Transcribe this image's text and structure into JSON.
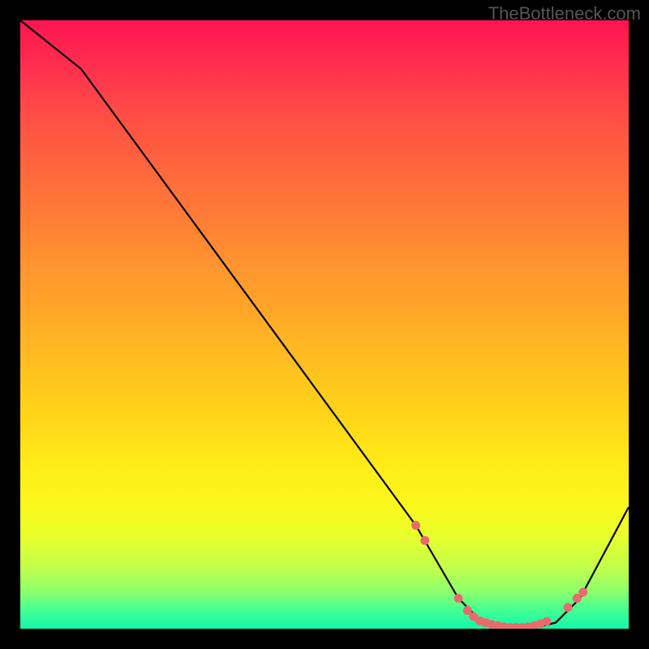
{
  "watermark": "TheBottleneck.com",
  "chart_data": {
    "type": "line",
    "title": "",
    "xlabel": "",
    "ylabel": "",
    "xlim": [
      0,
      100
    ],
    "ylim": [
      0,
      100
    ],
    "series": [
      {
        "name": "curve",
        "x": [
          0,
          10,
          65,
          72,
          76,
          80,
          84,
          88,
          92,
          100
        ],
        "y": [
          100,
          92,
          17,
          5,
          1,
          0,
          0,
          1,
          5,
          20
        ]
      }
    ],
    "markers": {
      "name": "highlighted-points",
      "color": "#e86b6b",
      "points": [
        {
          "x": 65.0,
          "y": 17.0
        },
        {
          "x": 66.5,
          "y": 14.5
        },
        {
          "x": 72.0,
          "y": 5.0
        },
        {
          "x": 73.5,
          "y": 3.0
        },
        {
          "x": 74.5,
          "y": 2.0
        },
        {
          "x": 75.5,
          "y": 1.3
        },
        {
          "x": 76.5,
          "y": 1.0
        },
        {
          "x": 77.5,
          "y": 0.7
        },
        {
          "x": 78.5,
          "y": 0.5
        },
        {
          "x": 79.5,
          "y": 0.3
        },
        {
          "x": 80.5,
          "y": 0.2
        },
        {
          "x": 81.5,
          "y": 0.2
        },
        {
          "x": 82.5,
          "y": 0.2
        },
        {
          "x": 83.5,
          "y": 0.3
        },
        {
          "x": 84.5,
          "y": 0.5
        },
        {
          "x": 85.5,
          "y": 0.8
        },
        {
          "x": 86.5,
          "y": 1.2
        },
        {
          "x": 90.0,
          "y": 3.5
        },
        {
          "x": 91.5,
          "y": 5.0
        },
        {
          "x": 92.5,
          "y": 6.0
        }
      ]
    }
  }
}
